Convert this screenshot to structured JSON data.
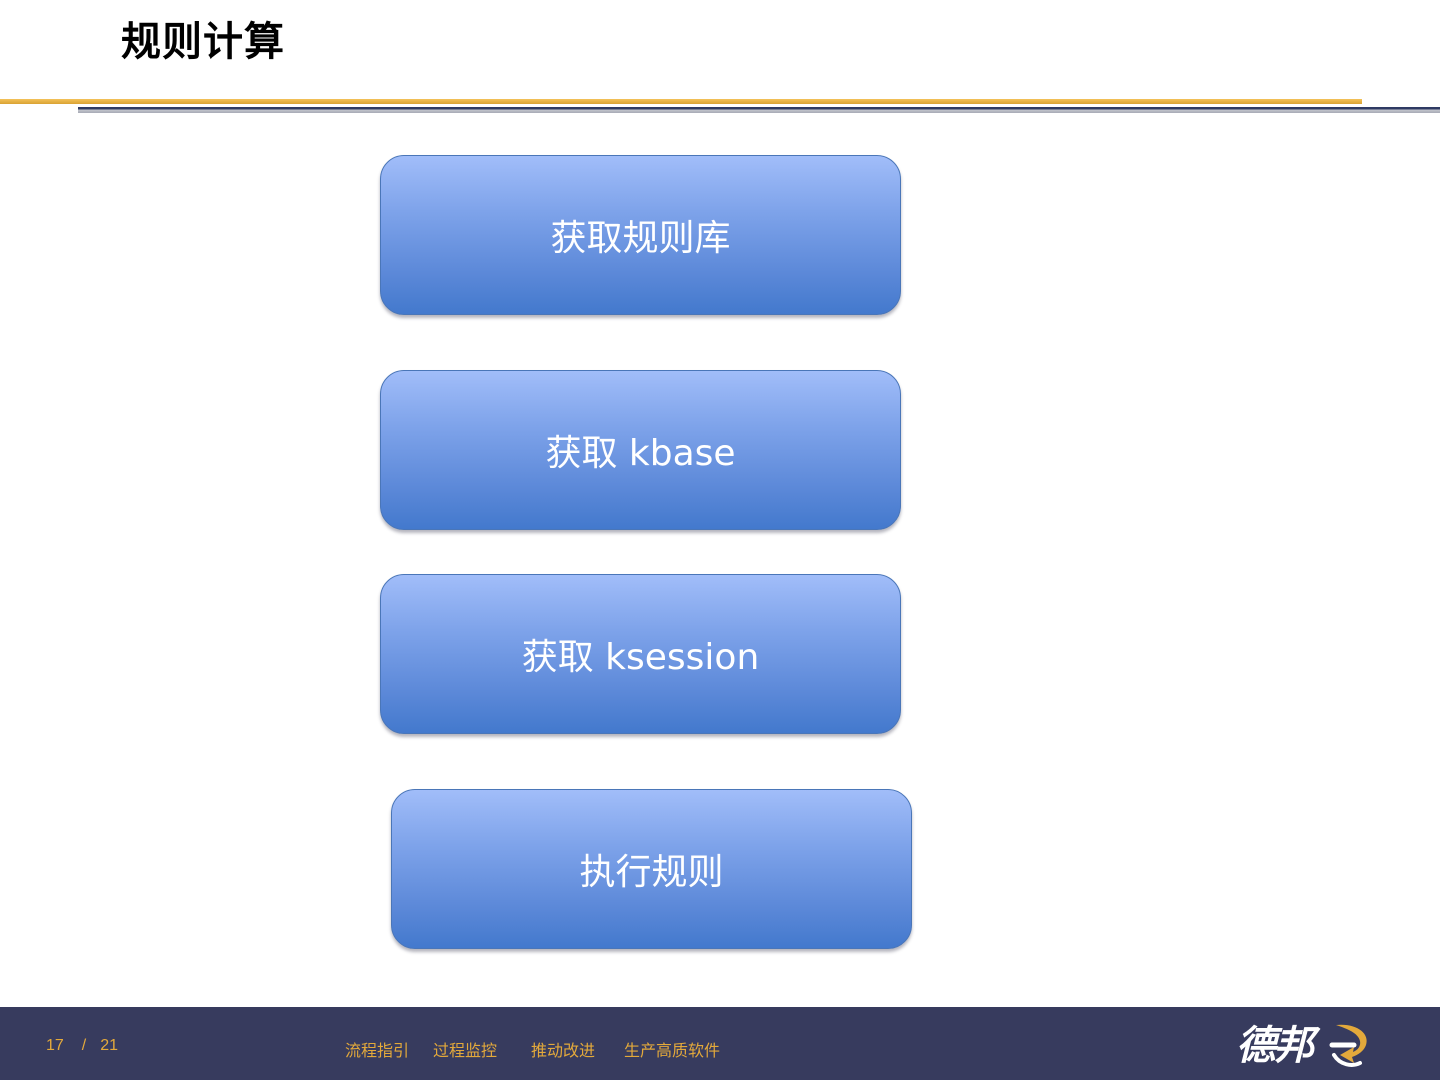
{
  "slide": {
    "title": "规则计算"
  },
  "steps": [
    {
      "label": "获取规则库"
    },
    {
      "label": "获取 kbase"
    },
    {
      "label": "获取 ksession"
    },
    {
      "label": "执行规则"
    }
  ],
  "footer": {
    "page_current": "17",
    "page_separator": "/",
    "page_total": "21",
    "taglines": [
      "流程指引",
      "过程监控",
      "推动改进",
      "生产高质软件"
    ],
    "logo_text": "德邦",
    "colors": {
      "background": "#373b5e",
      "accent": "#e3a93b"
    }
  },
  "colors": {
    "step_top": "#a1bdf9",
    "step_bottom": "#4379cd",
    "rule_gold": "#d9a233",
    "rule_dark": "#2e3a63"
  }
}
